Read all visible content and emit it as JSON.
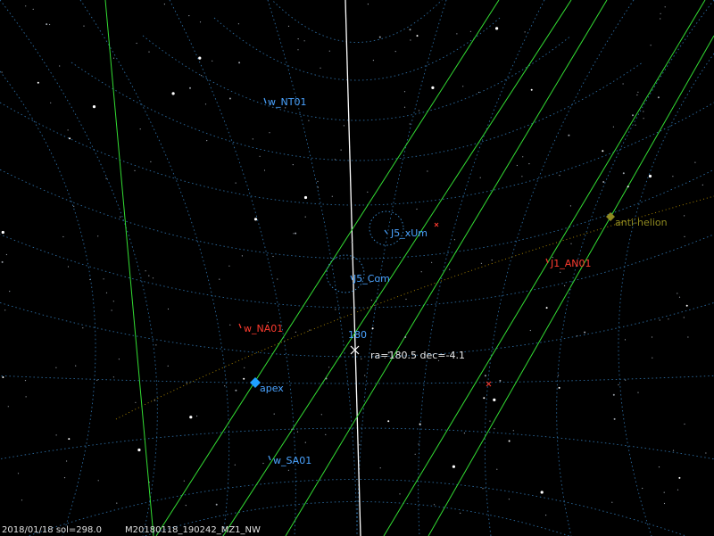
{
  "radiants": {
    "w_NT01": "w_NT01",
    "J5_xUm": "J5_xUm",
    "J5_Com": "J5_Com",
    "w_NA01": "w_NA01",
    "J1_AN01": "J1_AN01",
    "w_SA01": "w_SA01"
  },
  "markers": {
    "apex": "apex",
    "anti_helion": "anti-helion",
    "ra_value": "180",
    "cursor_readout": "ra=180.5 dec=-4.1"
  },
  "status": {
    "date_sol": "2018/01/18 sol=298.0",
    "file_id": "M20180118_190242_MZ1_NW"
  },
  "colors": {
    "background": "#000000",
    "grid": "#3b8fd6",
    "meteor_trail": "#33dd33",
    "meridian": "#ffffff",
    "stream_blue": "#4aa3ff",
    "stream_red": "#ff3b2f",
    "anti_helion": "#8f8a20",
    "ecliptic": "#b08a00"
  }
}
